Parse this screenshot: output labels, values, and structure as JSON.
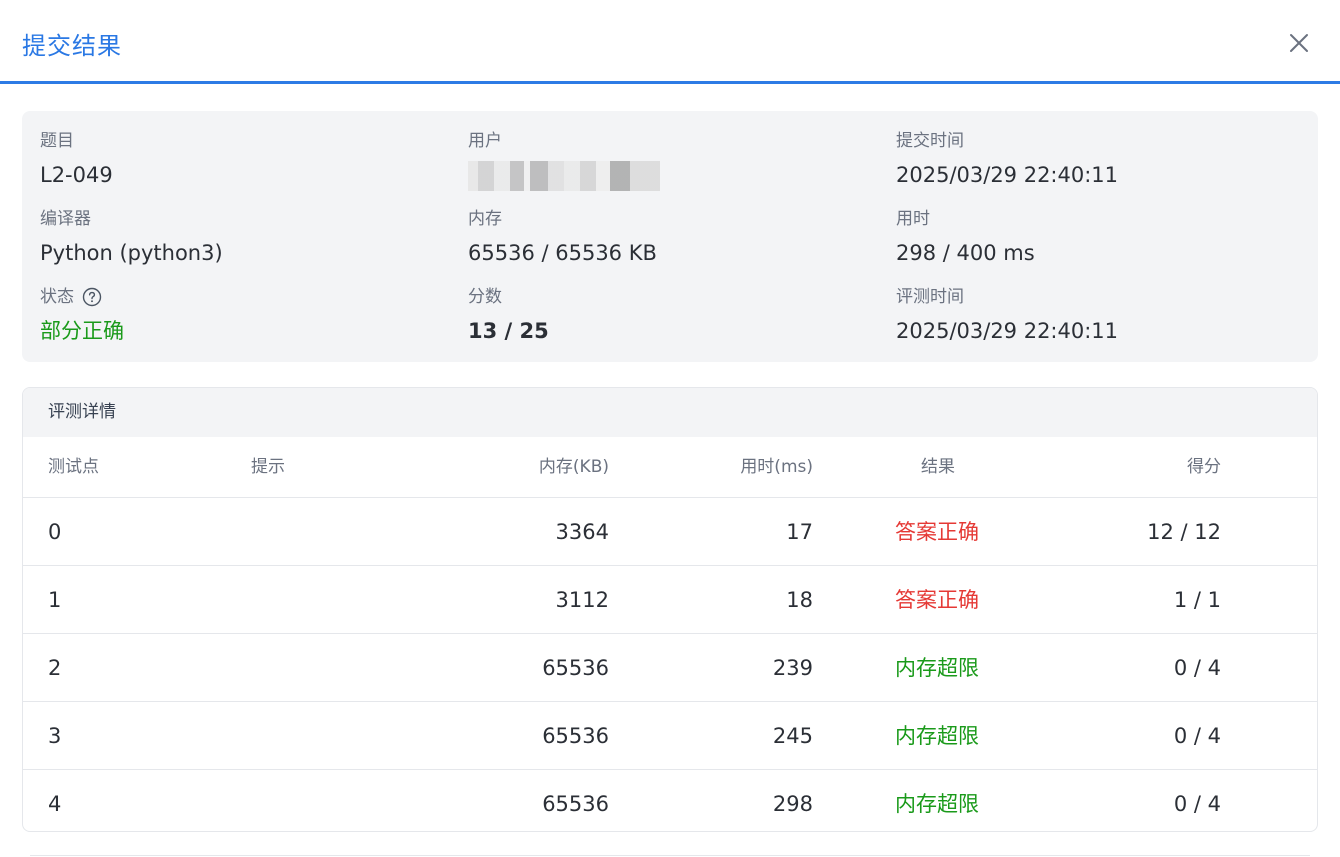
{
  "dialog": {
    "title": "提交结果"
  },
  "info": {
    "problem": {
      "label": "题目",
      "value": "L2-049"
    },
    "user": {
      "label": "用户",
      "value": ""
    },
    "submit_time": {
      "label": "提交时间",
      "value": "2025/03/29 22:40:11"
    },
    "compiler": {
      "label": "编译器",
      "value": "Python (python3)"
    },
    "memory": {
      "label": "内存",
      "value": "65536 / 65536 KB"
    },
    "time_used": {
      "label": "用时",
      "value": "298 / 400 ms"
    },
    "status": {
      "label": "状态",
      "value": "部分正确",
      "color": "#1a9a1a"
    },
    "score": {
      "label": "分数",
      "value": "13 / 25"
    },
    "judge_time": {
      "label": "评测时间",
      "value": "2025/03/29 22:40:11"
    }
  },
  "details": {
    "title": "评测详情",
    "columns": [
      "测试点",
      "提示",
      "内存(KB)",
      "用时(ms)",
      "结果",
      "得分"
    ],
    "rows": [
      {
        "case": "0",
        "hint": "",
        "memory": "3364",
        "time": "17",
        "result": "答案正确",
        "result_color": "#e53935",
        "score": "12 / 12"
      },
      {
        "case": "1",
        "hint": "",
        "memory": "3112",
        "time": "18",
        "result": "答案正确",
        "result_color": "#e53935",
        "score": "1 / 1"
      },
      {
        "case": "2",
        "hint": "",
        "memory": "65536",
        "time": "239",
        "result": "内存超限",
        "result_color": "#1a9a1a",
        "score": "0 / 4"
      },
      {
        "case": "3",
        "hint": "",
        "memory": "65536",
        "time": "245",
        "result": "内存超限",
        "result_color": "#1a9a1a",
        "score": "0 / 4"
      },
      {
        "case": "4",
        "hint": "",
        "memory": "65536",
        "time": "298",
        "result": "内存超限",
        "result_color": "#1a9a1a",
        "score": "0 / 4"
      }
    ]
  }
}
